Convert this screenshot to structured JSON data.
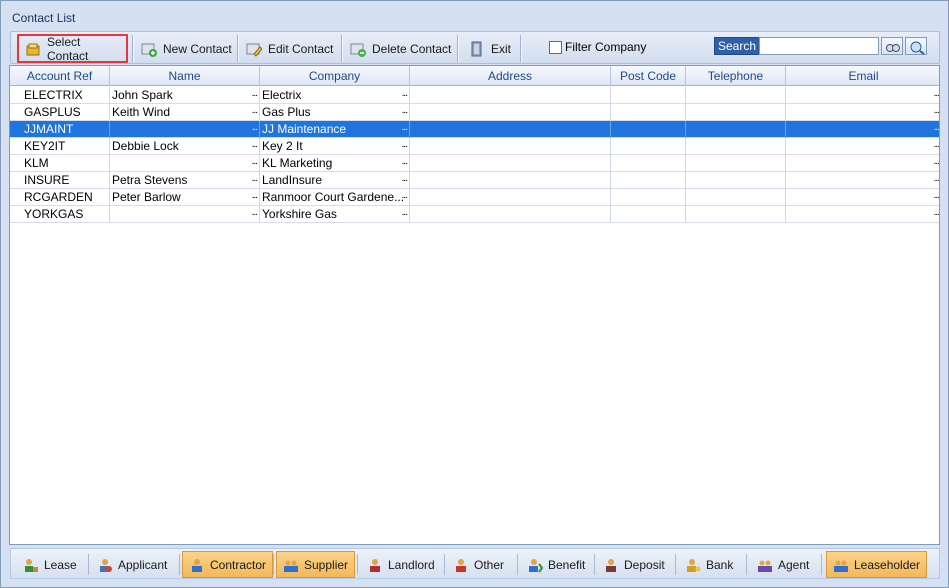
{
  "window": {
    "title": "Contact List"
  },
  "toolbar": {
    "buttons": [
      {
        "label": "Select Contact",
        "icon": "select-contact-icon"
      },
      {
        "label": "New Contact",
        "icon": "new-contact-icon"
      },
      {
        "label": "Edit Contact",
        "icon": "edit-contact-icon"
      },
      {
        "label": "Delete Contact",
        "icon": "delete-contact-icon"
      },
      {
        "label": "Exit",
        "icon": "exit-icon"
      }
    ],
    "filter_company": {
      "label": "Filter Company",
      "checked": false
    },
    "search": {
      "label": "Search",
      "value": ""
    }
  },
  "table": {
    "columns": [
      "Account Ref",
      "Name",
      "Company",
      "Address",
      "Post Code",
      "Telephone",
      "Email"
    ],
    "rows": [
      [
        "ELECTRIX",
        "John Spark",
        "Electrix",
        "",
        "",
        "",
        ""
      ],
      [
        "GASPLUS",
        "Keith Wind",
        "Gas Plus",
        "",
        "",
        "",
        ""
      ],
      [
        "JJMAINT",
        "",
        "JJ Maintenance",
        "",
        "",
        "",
        ""
      ],
      [
        "KEY2IT",
        "Debbie Lock",
        "Key 2 It",
        "",
        "",
        "",
        ""
      ],
      [
        "KLM",
        "",
        "KL Marketing",
        "",
        "",
        "",
        ""
      ],
      [
        "INSURE",
        "Petra Stevens",
        "LandInsure",
        "",
        "",
        "",
        ""
      ],
      [
        "RCGARDEN",
        "Peter Barlow",
        "Ranmoor Court Gardene...",
        "",
        "",
        "",
        ""
      ],
      [
        "YORKGAS",
        "",
        "Yorkshire Gas",
        "",
        "",
        "",
        ""
      ]
    ],
    "selected_row": 2,
    "ellipsis": "..."
  },
  "tabs": [
    {
      "label": "Lease",
      "active": false
    },
    {
      "label": "Applicant",
      "active": false
    },
    {
      "label": "Contractor",
      "active": true
    },
    {
      "label": "Supplier",
      "active": true
    },
    {
      "label": "Landlord",
      "active": false
    },
    {
      "label": "Other",
      "active": false
    },
    {
      "label": "Benefit",
      "active": false
    },
    {
      "label": "Deposit",
      "active": false
    },
    {
      "label": "Bank",
      "active": false
    },
    {
      "label": "Agent",
      "active": false
    },
    {
      "label": "Leaseholder",
      "active": true
    }
  ],
  "colors": {
    "accent": "#1f74dd",
    "active_tab": "#f3b85b",
    "highlight_border": "#e0383b"
  }
}
